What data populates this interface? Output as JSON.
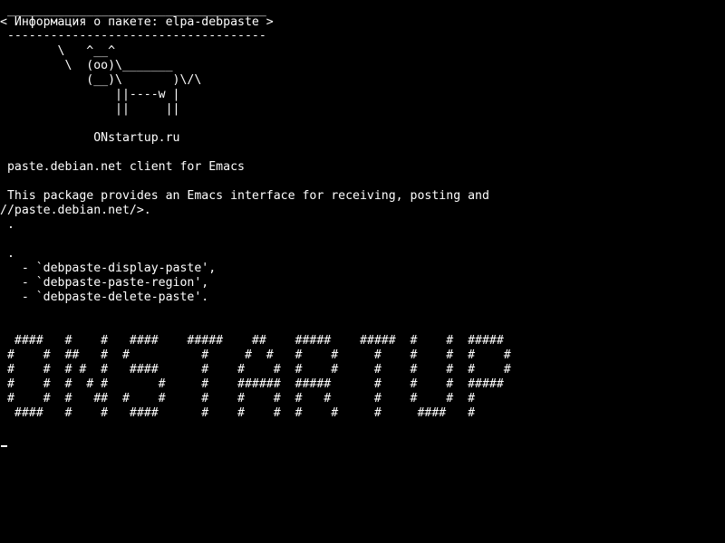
{
  "colors": {
    "background": "#000000",
    "foreground": "#ffffff"
  },
  "cowsay": {
    "border_top": " ____________________________________",
    "title": "< Информация о пакете: elpa-debpaste >",
    "border_bottom": " ------------------------------------",
    "cow": [
      "        \\   ^__^",
      "         \\  (oo)\\_______",
      "            (__)\\       )\\/\\",
      "                ||----w |",
      "                ||     ||"
    ]
  },
  "site": "             ONstartup.ru",
  "description": {
    "summary": " paste.debian.net client for Emacs",
    "body_line_1": " This package provides an Emacs interface for receiving, posting and",
    "body_line_2": "//paste.debian.net/>.",
    "dot_1": " .",
    "dot_2": " .",
    "commands": [
      "   - `debpaste-display-paste',",
      "   - `debpaste-paste-region',",
      "   - `debpaste-delete-paste'."
    ]
  },
  "banner": [
    "  ####   #    #   ####    #####    ##    #####    #####  #    #  #####",
    " #    #  ##   #  #          #     #  #   #    #     #    #    #  #    #",
    " #    #  # #  #   ####      #    #    #  #    #     #    #    #  #    #",
    " #    #  #  # #       #     #    ######  #####      #    #    #  #####",
    " #    #  #   ##  #    #     #    #    #  #   #      #    #    #  #",
    "  ####   #    #   ####      #    #    #  #    #     #     ####   #"
  ]
}
